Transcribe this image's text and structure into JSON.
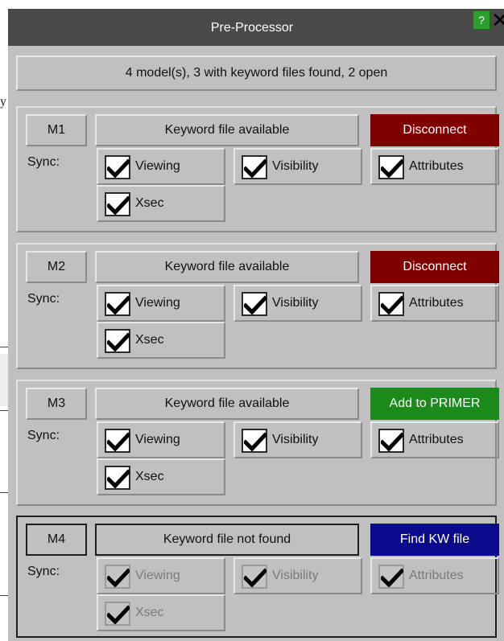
{
  "window": {
    "title": "Pre-Processor",
    "help_label": "?",
    "close_label": "✕"
  },
  "summary": "4 model(s), 3 with keyword files found, 2 open",
  "background": {
    "char": "y"
  },
  "sync_label": "Sync:",
  "models": [
    {
      "label": "M1",
      "status": "Keyword file available",
      "action": "Disconnect",
      "action_color": "#800000",
      "enabled": true,
      "options": {
        "viewing": "Viewing",
        "visibility": "Visibility",
        "attributes": "Attributes",
        "xsec": "Xsec"
      },
      "checked": {
        "viewing": true,
        "visibility": true,
        "attributes": true,
        "xsec": true
      }
    },
    {
      "label": "M2",
      "status": "Keyword file available",
      "action": "Disconnect",
      "action_color": "#800000",
      "enabled": true,
      "options": {
        "viewing": "Viewing",
        "visibility": "Visibility",
        "attributes": "Attributes",
        "xsec": "Xsec"
      },
      "checked": {
        "viewing": true,
        "visibility": true,
        "attributes": true,
        "xsec": true
      }
    },
    {
      "label": "M3",
      "status": "Keyword file available",
      "action": "Add to PRIMER",
      "action_color": "#1a8a1a",
      "enabled": true,
      "options": {
        "viewing": "Viewing",
        "visibility": "Visibility",
        "attributes": "Attributes",
        "xsec": "Xsec"
      },
      "checked": {
        "viewing": true,
        "visibility": true,
        "attributes": true,
        "xsec": true
      }
    },
    {
      "label": "M4",
      "status": "Keyword file not found",
      "action": "Find KW file",
      "action_color": "#0a0a8c",
      "enabled": false,
      "options": {
        "viewing": "Viewing",
        "visibility": "Visibility",
        "attributes": "Attributes",
        "xsec": "Xsec"
      },
      "checked": {
        "viewing": true,
        "visibility": true,
        "attributes": true,
        "xsec": true
      }
    }
  ],
  "icons": {
    "check": "checkmark-icon",
    "help": "help-icon",
    "close": "close-icon"
  }
}
